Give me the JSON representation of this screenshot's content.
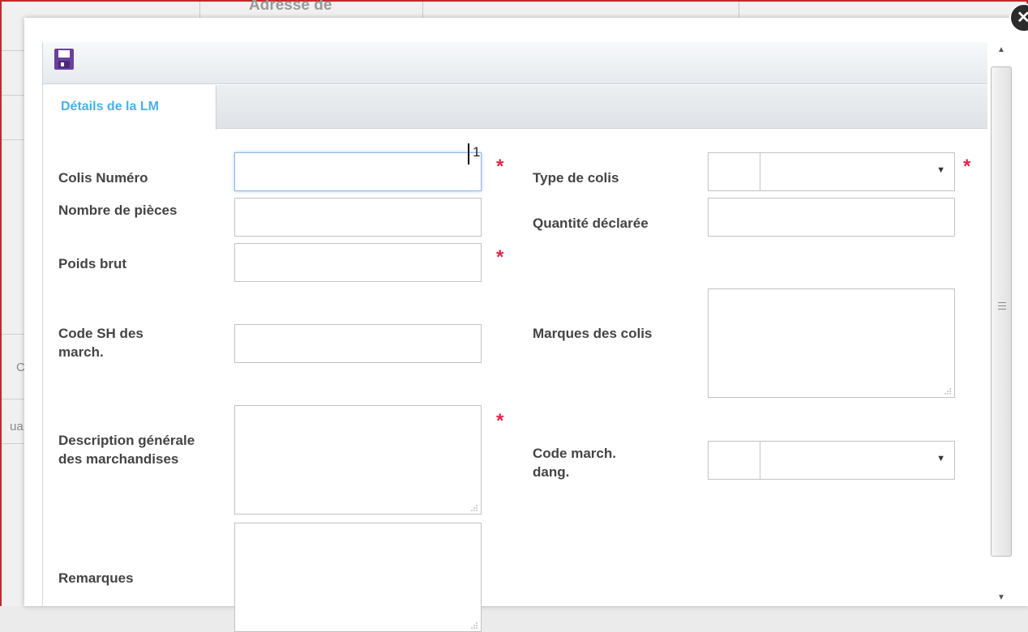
{
  "background": {
    "header_text": "Adresse de",
    "frag1": "C",
    "frag2": "ua"
  },
  "close_icon_glyph": "✕",
  "toolbar": {
    "save_icon": "save-icon"
  },
  "tabs": [
    {
      "label": "Détails de la LM",
      "active": true
    }
  ],
  "form": {
    "colis_numero": {
      "label": "Colis Numéro",
      "value": "1",
      "required": true
    },
    "nombre_pieces": {
      "label": "Nombre de pièces",
      "value": ""
    },
    "poids_brut": {
      "label": "Poids brut",
      "value": "",
      "required": true
    },
    "code_sh": {
      "label": "Code SH des march.",
      "value": ""
    },
    "description": {
      "label": "Description générale des marchandises",
      "value": "",
      "required": true
    },
    "remarques": {
      "label": "Remarques",
      "value": ""
    },
    "type_colis": {
      "label": "Type de colis",
      "value": "",
      "required": true
    },
    "quantite": {
      "label": "Quantité déclarée",
      "value": ""
    },
    "marques": {
      "label": "Marques des colis",
      "value": ""
    },
    "code_march_dang": {
      "label": "Code march. dang.",
      "value": ""
    }
  },
  "required_marker": "*",
  "colors": {
    "accent_tab": "#4ab0e8",
    "required": "#e8234a",
    "save_icon": "#6b3fa0"
  }
}
